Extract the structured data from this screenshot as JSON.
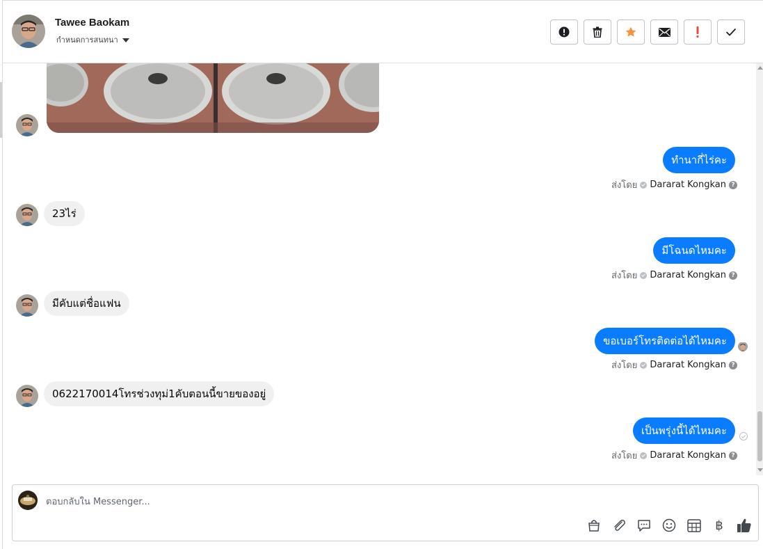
{
  "header": {
    "contact_name": "Tawee Baokam",
    "conversation_subtitle": "กำหนดการสนทนา",
    "tool_icons": [
      "alert-circle-icon",
      "trash-icon",
      "star-icon",
      "envelope-icon",
      "exclamation-icon",
      "check-icon"
    ],
    "star_color": "#f7923b",
    "exclamation_color": "#e4493b"
  },
  "messages": [
    {
      "type": "image",
      "from": "contact",
      "alt": "photo of cooking pans"
    },
    {
      "type": "text",
      "from": "page",
      "text": "ทำนากี่ไร่คะ",
      "sent_by_label": "ส่งโดย",
      "agent": "Dararat Kongkan"
    },
    {
      "type": "text",
      "from": "contact",
      "text": "23ไร่"
    },
    {
      "type": "text",
      "from": "page",
      "text": "มีโฉนดไหมคะ",
      "sent_by_label": "ส่งโดย",
      "agent": "Dararat Kongkan"
    },
    {
      "type": "text",
      "from": "contact",
      "text": "มีคับแต่ชื่อแฟน"
    },
    {
      "type": "text",
      "from": "page",
      "text": "ขอเบอร์โทรติดต่อได้ไหมคะ",
      "sent_by_label": "ส่งโดย",
      "agent": "Dararat Kongkan"
    },
    {
      "type": "text",
      "from": "contact",
      "text": "0622170014โทรช่วงทุม่1คับตอนนี้ขายของอยู่"
    },
    {
      "type": "text",
      "from": "page",
      "text": "เป็นพรุ่งนี้ได้ไหมคะ",
      "sent_by_label": "ส่งโดย",
      "agent": "Dararat Kongkan"
    }
  ],
  "composer": {
    "placeholder": "ตอบกลับใน Messenger...",
    "icons": [
      "shopping-bag-icon",
      "paperclip-icon",
      "saved-reply-icon",
      "emoji-icon",
      "table-icon",
      "baht-icon",
      "thumbs-up-icon"
    ],
    "baht_symbol": "฿",
    "accent": "#0a7cff"
  },
  "colors": {
    "outgoing_bubble": "#0a7cff",
    "incoming_bubble": "#f0f0f0"
  }
}
